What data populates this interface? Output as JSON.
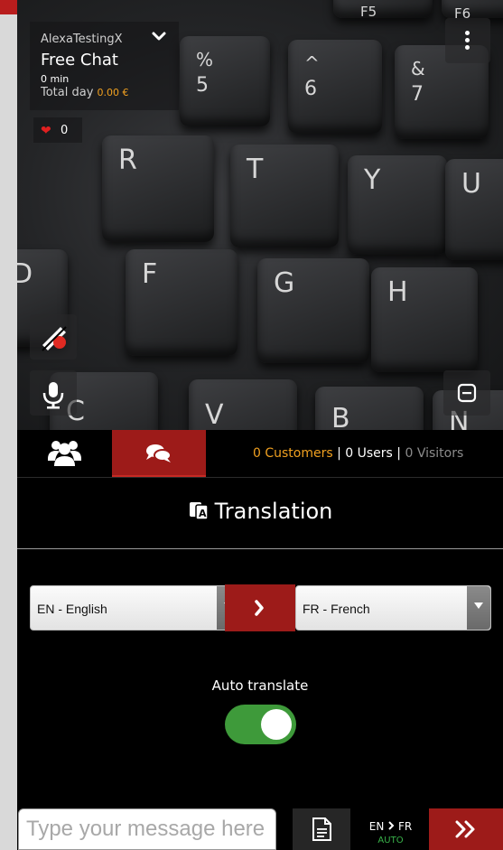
{
  "header": {
    "username": "AlexaTestingX",
    "chat_type": "Free Chat",
    "duration": "0 min",
    "total_label": "Total day",
    "total_amount": "0.00 €",
    "likes": "0"
  },
  "tabs": {
    "counts": {
      "customers": "0 Customers",
      "users": "0 Users",
      "visitors": "0 Visitors",
      "separator": "|"
    }
  },
  "translation": {
    "title": "Translation",
    "from_language": "EN - English",
    "to_language": "FR - French",
    "auto_translate_label": "Auto translate",
    "auto_translate_on": true
  },
  "composer": {
    "placeholder": "Type your message here",
    "pair_from": "EN",
    "pair_to": "FR",
    "mode": "AUTO"
  },
  "colors": {
    "accent_red": "#9d1b19",
    "amount_orange": "#f0a020",
    "toggle_green": "#3e9a3a",
    "auto_green": "#39b24a"
  },
  "video_keys": [
    "F5",
    "F6",
    "%",
    "5",
    "^",
    "6",
    "&",
    "7",
    "R",
    "T",
    "Y",
    "U",
    "D",
    "F",
    "G",
    "H",
    "C",
    "V",
    "B",
    "N"
  ],
  "icons": [
    "chevron-down-icon",
    "more-vertical-icon",
    "heart-icon",
    "camera-off-icon",
    "microphone-icon",
    "minimize-icon",
    "users-icon",
    "chat-bubbles-icon",
    "translate-icon",
    "chevron-right-icon",
    "document-icon",
    "double-chevron-right-icon"
  ]
}
